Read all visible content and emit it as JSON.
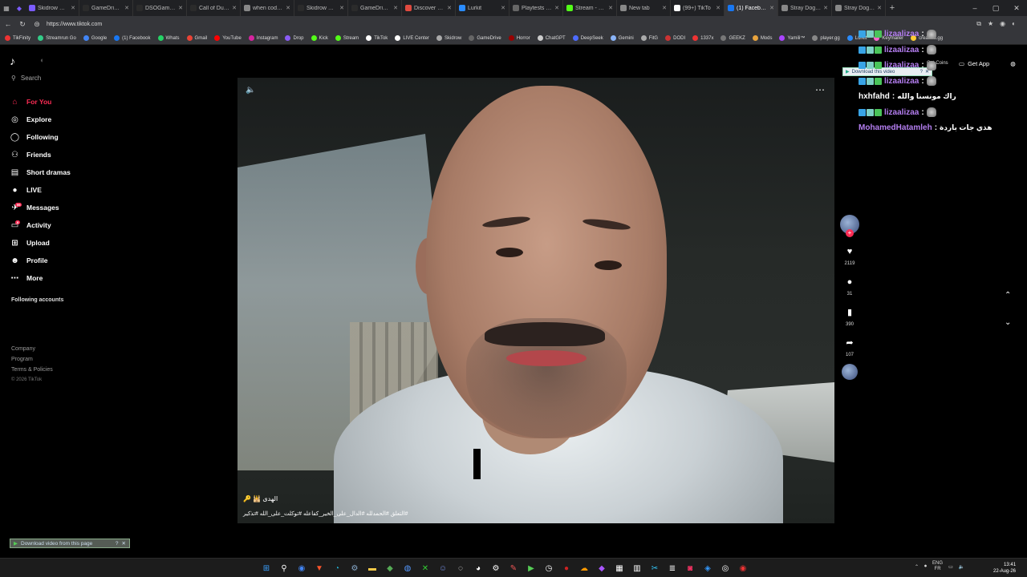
{
  "browser": {
    "tabs": [
      {
        "label": "Skidrow & Rel",
        "color": "#7b5cff"
      },
      {
        "label": "GameDrive - F",
        "color": "#2b2b2b"
      },
      {
        "label": "DSOGaming -",
        "color": "#2b2b2b"
      },
      {
        "label": "Call of Duty M",
        "color": "#2b2b2b"
      },
      {
        "label": "when cod beta",
        "color": "#888"
      },
      {
        "label": "Skidrow & Rel",
        "color": "#2b2b2b"
      },
      {
        "label": "GameDrive - F",
        "color": "#2b2b2b"
      },
      {
        "label": "Discover Gam",
        "color": "#e04a3f"
      },
      {
        "label": "Lurkit",
        "color": "#2a8cff"
      },
      {
        "label": "Playtests — pl",
        "color": "#666"
      },
      {
        "label": "Stream - Kick",
        "color": "#53fc18"
      },
      {
        "label": "New tab",
        "color": "#888"
      },
      {
        "label": "(99+) TikTo",
        "color": "#fff"
      },
      {
        "label": "(1) Facebook",
        "color": "#1877f2"
      },
      {
        "label": "Stray Dog Gam",
        "color": "#888"
      },
      {
        "label": "Stray Dogs no",
        "color": "#888"
      }
    ],
    "active_tab": 13,
    "url": "https://www.tiktok.com",
    "bookmarks": [
      {
        "label": "TikFinity",
        "color": "#e33"
      },
      {
        "label": "Streamrun Go",
        "color": "#3c8"
      },
      {
        "label": "Google",
        "color": "#4285f4"
      },
      {
        "label": "(1) Facebook",
        "color": "#1877f2"
      },
      {
        "label": "Whats",
        "color": "#25d366"
      },
      {
        "label": "Gmail",
        "color": "#ea4335"
      },
      {
        "label": "YouTube",
        "color": "#f00"
      },
      {
        "label": "Instagram",
        "color": "#d6249f"
      },
      {
        "label": "Drop",
        "color": "#8b5cf6"
      },
      {
        "label": "Kick",
        "color": "#53fc18"
      },
      {
        "label": "Stream",
        "color": "#53fc18"
      },
      {
        "label": "TikTok",
        "color": "#fff"
      },
      {
        "label": "LIVE Center",
        "color": "#fff"
      },
      {
        "label": "Skidrow",
        "color": "#aaa"
      },
      {
        "label": "GameDrive",
        "color": "#666"
      },
      {
        "label": "Horror",
        "color": "#900"
      },
      {
        "label": "ChatGPT",
        "color": "#ccc"
      },
      {
        "label": "DeepSeek",
        "color": "#4d6bfe"
      },
      {
        "label": "Gemini",
        "color": "#8ab4f8"
      },
      {
        "label": "FitG",
        "color": "#aaa"
      },
      {
        "label": "DODI",
        "color": "#c33"
      },
      {
        "label": "1337x",
        "color": "#e33"
      },
      {
        "label": "GEEKZ",
        "color": "#777"
      },
      {
        "label": "Mods",
        "color": "#e8a33d"
      },
      {
        "label": "Yamili™",
        "color": "#a4f"
      },
      {
        "label": "player.gg",
        "color": "#888"
      },
      {
        "label": "Lurkit",
        "color": "#2a8cff"
      },
      {
        "label": "Keymailer",
        "color": "#f6c"
      },
      {
        "label": "creators.gg",
        "color": "#fc3"
      }
    ]
  },
  "sidebar": {
    "logo": "♪",
    "search_placeholder": "Search",
    "items": [
      {
        "label": "For You",
        "icon": "⌂",
        "name": "for-you"
      },
      {
        "label": "Explore",
        "icon": "◎",
        "name": "explore"
      },
      {
        "label": "Following",
        "icon": "◯",
        "name": "following"
      },
      {
        "label": "Friends",
        "icon": "⚇",
        "name": "friends"
      },
      {
        "label": "Short dramas",
        "icon": "▤",
        "name": "short-dramas"
      },
      {
        "label": "LIVE",
        "icon": "●",
        "name": "live"
      },
      {
        "label": "Messages",
        "icon": "✈",
        "name": "messages",
        "badge": "99"
      },
      {
        "label": "Activity",
        "icon": "▭",
        "name": "activity",
        "badge": "8"
      },
      {
        "label": "Upload",
        "icon": "⊞",
        "name": "upload"
      },
      {
        "label": "Profile",
        "icon": "☻",
        "name": "profile"
      },
      {
        "label": "More",
        "icon": "⋯",
        "name": "more"
      }
    ],
    "following_accounts": "Following accounts",
    "footer": [
      "Company",
      "Program",
      "Terms & Policies"
    ],
    "copyright": "© 2026 TikTok"
  },
  "video": {
    "author": "الهدى 🕌 🔑",
    "hashtags": "#التعلق #الحمدلله #الدال_على_الخير_كفاعله #توكلت_على_الله #تذكير"
  },
  "actions": {
    "likes": "2119",
    "comments": "31",
    "saves": "390",
    "shares": "107"
  },
  "topright": {
    "get_coins": "Get Coins",
    "get_app": "Get App",
    "download_video": "Download this video",
    "download_page": "Download video from this page"
  },
  "chat": [
    {
      "user": "lizaalizaa",
      "msg": "",
      "badges": true,
      "white": false
    },
    {
      "user": "lizaalizaa",
      "msg": "",
      "badges": true,
      "white": false
    },
    {
      "user": "lizaalizaa",
      "msg": "",
      "badges": true,
      "white": false
    },
    {
      "user": "lizaalizaa",
      "msg": "",
      "badges": true,
      "white": false
    },
    {
      "user": "hxhfahd",
      "msg": "راك مونسنا والله",
      "badges": false,
      "white": true
    },
    {
      "user": "lizaalizaa",
      "msg": "",
      "badges": true,
      "white": false
    },
    {
      "user": "MohamedHatamleh",
      "msg": "هذي جات باردة",
      "badges": false,
      "white": false
    }
  ],
  "taskbar": {
    "lang_top": "ENG",
    "lang_bottom": "FR",
    "time": "13:41",
    "date": "22-Aug-26"
  }
}
